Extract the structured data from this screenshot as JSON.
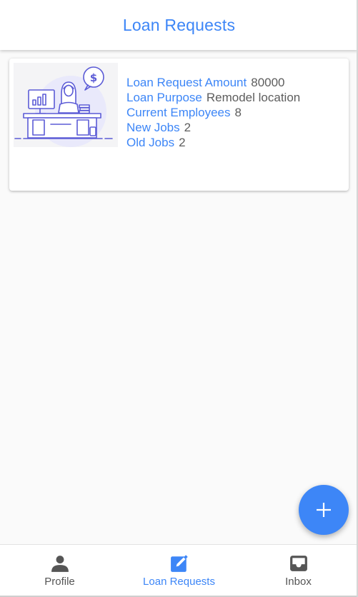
{
  "header": {
    "title": "Loan Requests"
  },
  "loan_card": {
    "image_icon": "office-desk-illustration",
    "fields": [
      {
        "label": "Loan Request Amount",
        "value": "80000"
      },
      {
        "label": "Loan Purpose",
        "value": "Remodel location"
      },
      {
        "label": "Current Employees",
        "value": "8"
      },
      {
        "label": "New Jobs",
        "value": "2"
      },
      {
        "label": "Old Jobs",
        "value": "2"
      }
    ]
  },
  "fab": {
    "icon": "plus-icon"
  },
  "bottom_nav": {
    "items": [
      {
        "label": "Profile",
        "icon": "person-icon",
        "active": false
      },
      {
        "label": "Loan Requests",
        "icon": "edit-icon",
        "active": true
      },
      {
        "label": "Inbox",
        "icon": "inbox-icon",
        "active": false
      }
    ]
  },
  "colors": {
    "accent": "#3d86f7",
    "text": "#5d5d5d",
    "icon_gray": "#555555",
    "background": "#fafafa"
  }
}
